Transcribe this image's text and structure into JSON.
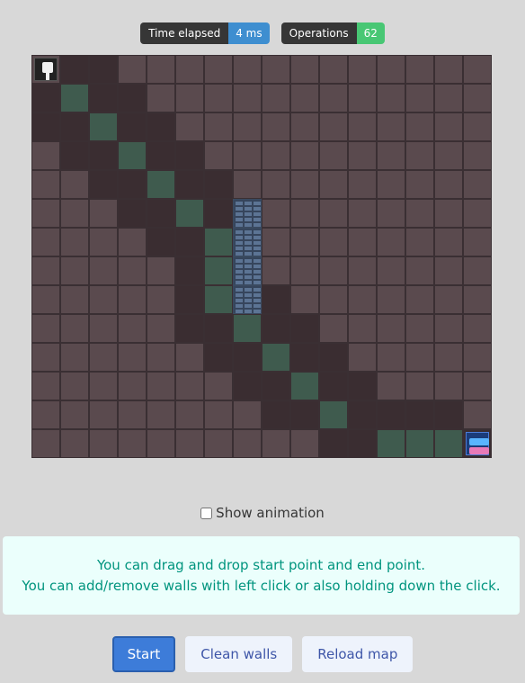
{
  "stats": {
    "time_label": "Time elapsed",
    "time_value": "4 ms",
    "ops_label": "Operations",
    "ops_value": "62"
  },
  "grid": {
    "cols": 16,
    "rows": 14,
    "cells": [
      "SVV.............",
      "VPVV............",
      "VVPVV...........",
      ".VVPVV..........",
      "..VVPVV.........",
      "...VVPVW........",
      "....VVPW........",
      ".....VPW........",
      ".....VPWV.......",
      ".....VVPVV......",
      "......VVPVV.....",
      ".......VVPVV....",
      "........VVPVVVV.",
      "..........VVPPPE"
    ],
    "legend": {
      "S": "start",
      "E": "end",
      "W": "wall",
      "P": "path",
      "V": "visited",
      ".": "empty"
    },
    "colors": {
      "empty": "#5a4a4e",
      "visited": "#3a2d31",
      "path": "#3f5b4e",
      "wall": "#5c7494"
    }
  },
  "animation": {
    "label": "Show animation",
    "checked": false
  },
  "notice": {
    "line1": "You can drag and drop start point and end point.",
    "line2": "You can add/remove walls with left click or also holding down the click."
  },
  "buttons": {
    "start": "Start",
    "clean": "Clean walls",
    "reload": "Reload map"
  }
}
